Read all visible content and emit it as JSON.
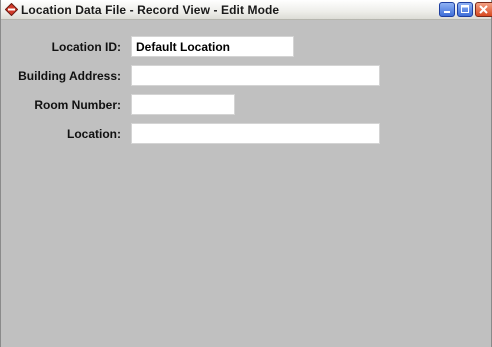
{
  "window": {
    "title": "Location Data File - Record View - Edit Mode"
  },
  "form": {
    "location_id_label": "Location ID:",
    "location_id_value": "Default Location",
    "building_address_label": "Building Address:",
    "building_address_value": "",
    "room_number_label": "Room Number:",
    "room_number_value": "",
    "location_label": "Location:",
    "location_value": ""
  },
  "icons": {
    "app": "diamond-app-icon",
    "minimize": "minimize-icon",
    "maximize": "maximize-icon",
    "close": "close-icon"
  },
  "colors": {
    "form_background": "#c0c0c0",
    "input_background": "#ffffff",
    "close_button": "#d8491f",
    "title_buttons": "#3f6fd8"
  }
}
